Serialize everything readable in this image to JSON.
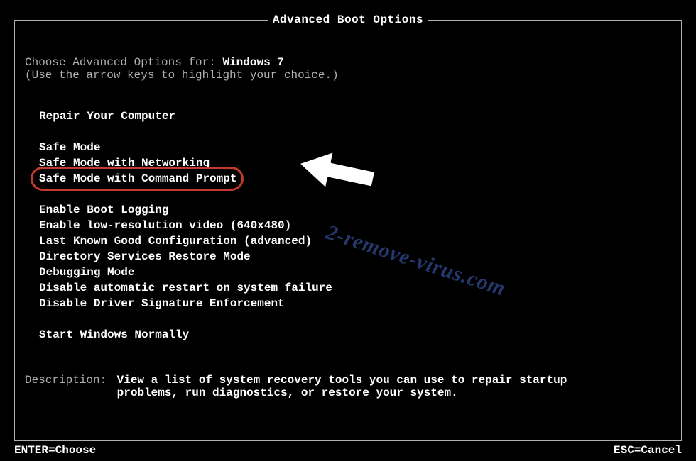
{
  "title": "Advanced Boot Options",
  "intro": {
    "prefix": "Choose Advanced Options for: ",
    "os": "Windows 7",
    "hint": "(Use the arrow keys to highlight your choice.)"
  },
  "groups": {
    "repair": "Repair Your Computer",
    "safe": [
      "Safe Mode",
      "Safe Mode with Networking",
      "Safe Mode with Command Prompt"
    ],
    "advanced": [
      "Enable Boot Logging",
      "Enable low-resolution video (640x480)",
      "Last Known Good Configuration (advanced)",
      "Directory Services Restore Mode",
      "Debugging Mode",
      "Disable automatic restart on system failure",
      "Disable Driver Signature Enforcement"
    ],
    "normal": "Start Windows Normally"
  },
  "description": {
    "label": "Description:",
    "text": "View a list of system recovery tools you can use to repair startup problems, run diagnostics, or restore your system."
  },
  "footer": {
    "enter": "ENTER=Choose",
    "esc": "ESC=Cancel"
  },
  "watermark": "2-remove-virus.com"
}
